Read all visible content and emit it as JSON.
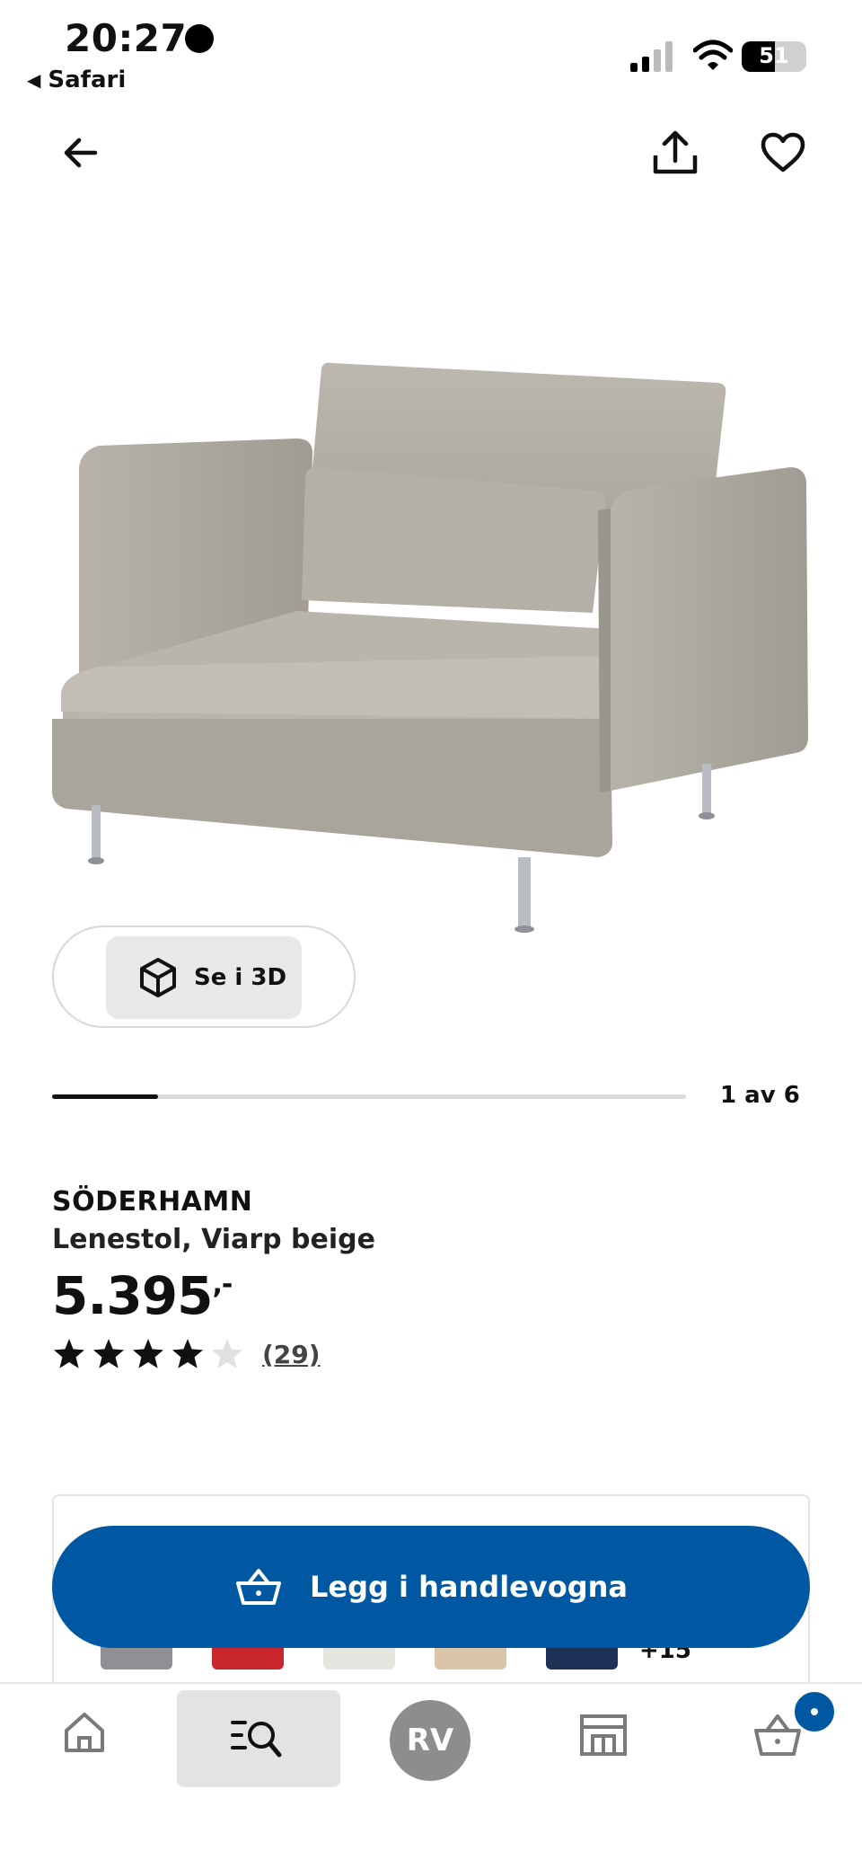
{
  "status_bar": {
    "time": "20:27",
    "back_app": "Safari",
    "battery_percent": "51",
    "battery_level": 0.51
  },
  "icons": {
    "back": "arrow-left-icon",
    "share": "share-icon",
    "favorite": "heart-icon",
    "view3d": "cube-icon",
    "cart": "shopping-basket-icon",
    "nav_home": "home-icon",
    "nav_search": "search-list-icon",
    "nav_stores": "store-icon",
    "nav_cart": "basket-icon"
  },
  "gallery": {
    "see_3d_label": "Se i 3D",
    "counter": "1 av 6",
    "progress": 0.1667
  },
  "product": {
    "name": "SÖDERHAMN",
    "description": "Lenestol, Viarp beige",
    "price": "5.395",
    "price_suffix": ",-",
    "rating": 4,
    "rating_max": 5,
    "review_count": "(29)"
  },
  "variants": {
    "colors": [
      "#8f9094",
      "#c8262c",
      "#e6e4df",
      "#d9c6a8",
      "#1f3156"
    ],
    "more": "+15"
  },
  "cart_button": {
    "label": "Legg i handlevogna",
    "color": "#0058a3"
  },
  "bottom_nav": {
    "avatar_initials": "RV",
    "active": "search"
  },
  "colors": {
    "brand_blue": "#0058a3",
    "star_filled": "#111111",
    "star_empty": "#e0e0e0"
  }
}
